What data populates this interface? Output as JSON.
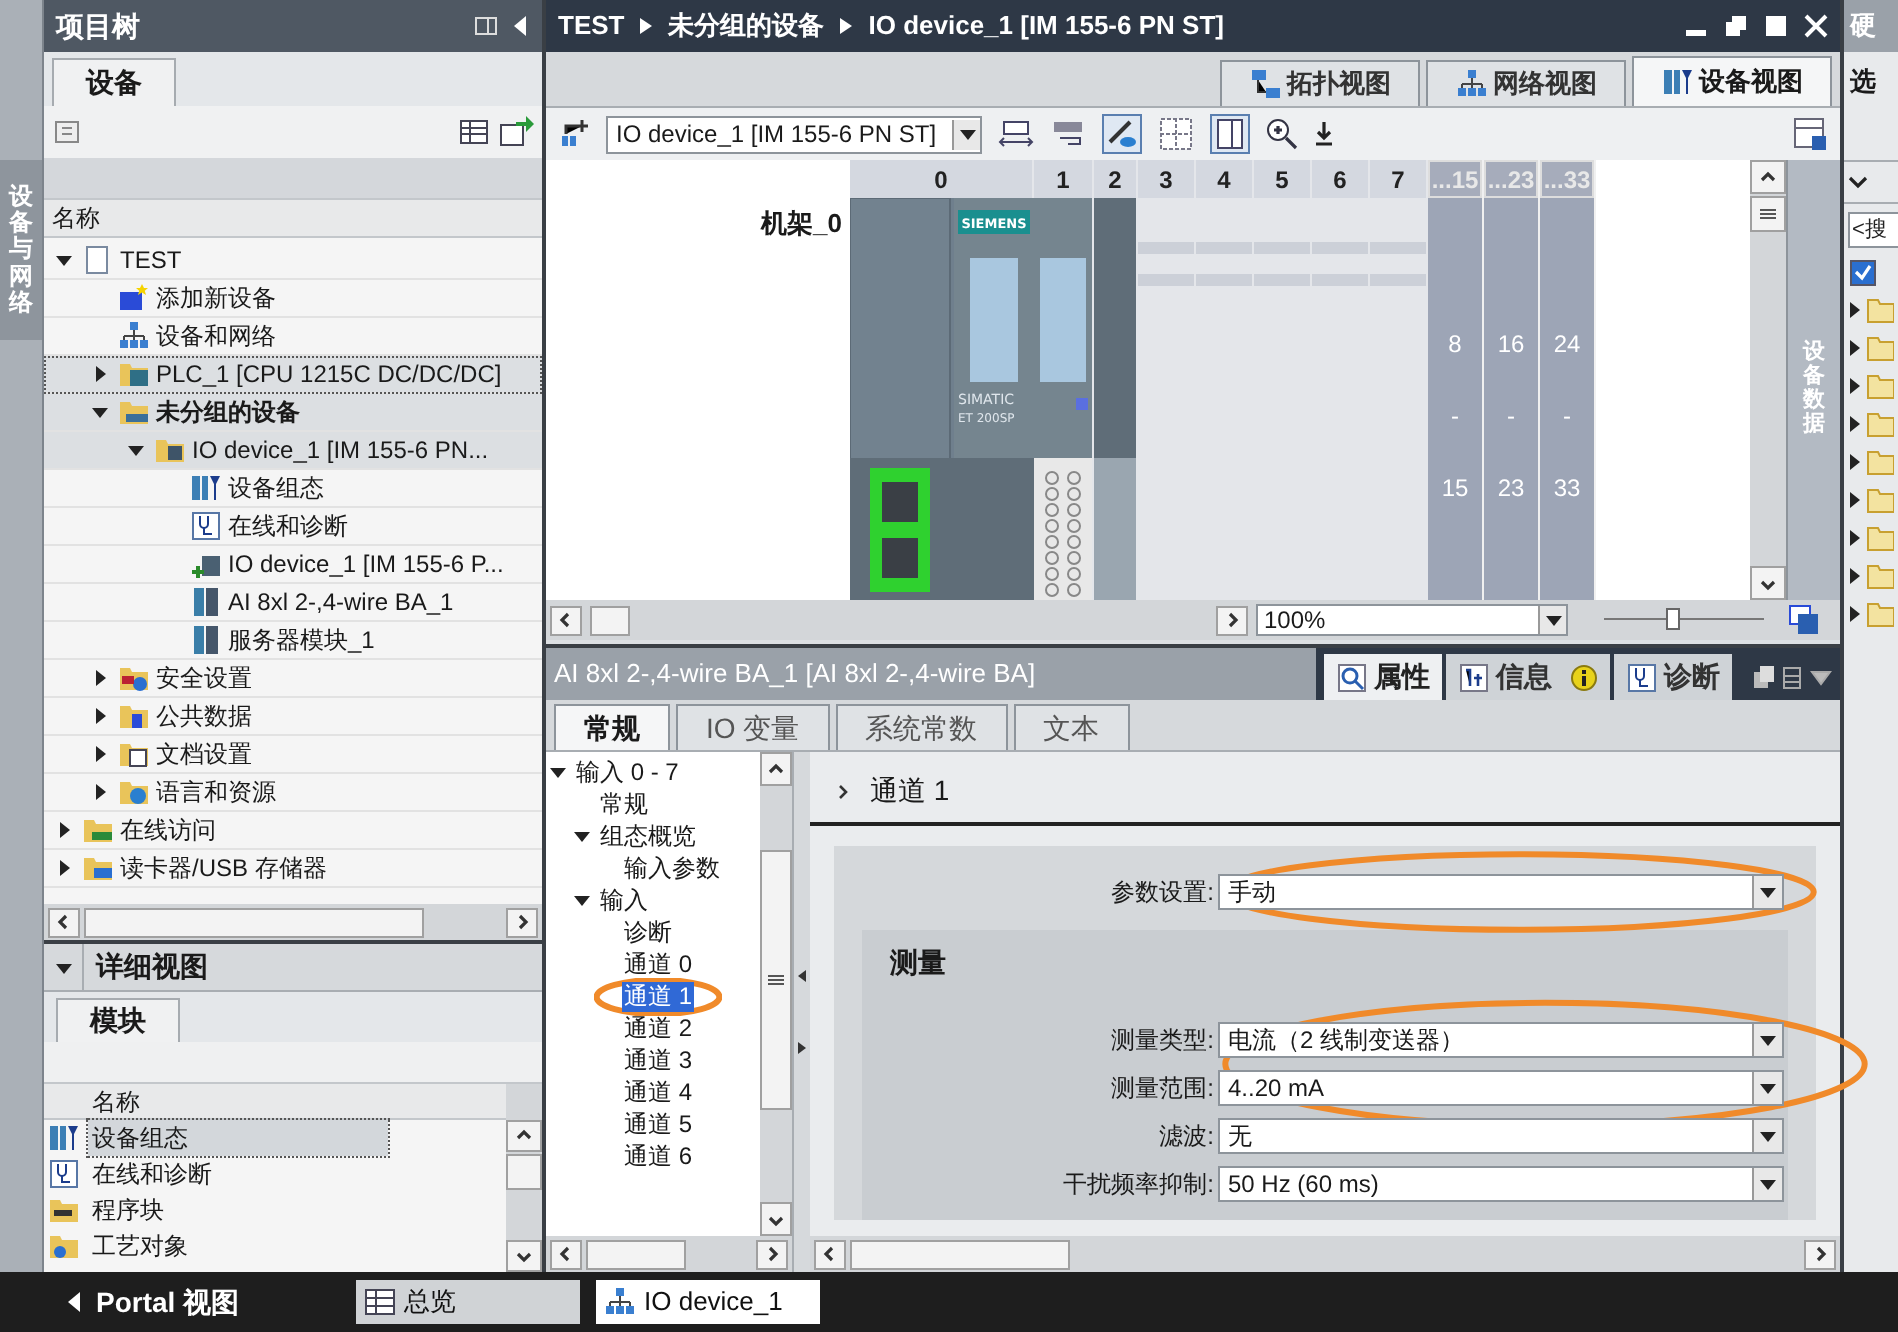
{
  "side_strip": {
    "label": "设备与网络"
  },
  "project_tree": {
    "title": "项目树",
    "tabs": [
      {
        "label": "设备",
        "selected": true
      }
    ],
    "column": "名称",
    "items": [
      {
        "label": "TEST",
        "kind": "project",
        "expanded": true,
        "highlighted": false,
        "selected": false,
        "children": [
          {
            "label": "添加新设备",
            "kind": "add-device",
            "selected": false
          },
          {
            "label": "设备和网络",
            "kind": "network",
            "selected": false
          },
          {
            "label": "PLC_1 [CPU 1215C DC/DC/DC]",
            "kind": "plc",
            "expanded": false,
            "highlighted": true,
            "selected": true
          },
          {
            "label": "未分组的设备",
            "kind": "group",
            "expanded": true,
            "highlighted": true,
            "bold": true,
            "selected": false,
            "children": [
              {
                "label": "IO device_1 [IM 155-6 PN...",
                "kind": "device",
                "expanded": true,
                "highlighted": true,
                "selected": false,
                "children": [
                  {
                    "label": "设备组态",
                    "kind": "config",
                    "selected": false
                  },
                  {
                    "label": "在线和诊断",
                    "kind": "diagnostics",
                    "selected": false
                  },
                  {
                    "label": "IO device_1 [IM 155-6 P...",
                    "kind": "device-module",
                    "selected": false
                  },
                  {
                    "label": "AI 8xl 2-,4-wire BA_1",
                    "kind": "module",
                    "selected": false
                  },
                  {
                    "label": "服务器模块_1",
                    "kind": "module",
                    "selected": false
                  }
                ]
              }
            ]
          },
          {
            "label": "安全设置",
            "kind": "security",
            "expanded": false,
            "highlighted": false,
            "selected": false
          },
          {
            "label": "公共数据",
            "kind": "common-data",
            "expanded": false,
            "highlighted": false,
            "selected": false
          },
          {
            "label": "文档设置",
            "kind": "document",
            "expanded": false,
            "highlighted": false,
            "selected": false
          },
          {
            "label": "语言和资源",
            "kind": "language",
            "expanded": false,
            "highlighted": false,
            "selected": false
          }
        ]
      },
      {
        "label": "在线访问",
        "kind": "online",
        "expanded": false,
        "highlighted": false,
        "selected": false
      },
      {
        "label": "读卡器/USB 存储器",
        "kind": "card-reader",
        "expanded": false,
        "highlighted": false,
        "selected": false
      }
    ]
  },
  "detail_view": {
    "title": "详细视图",
    "expanded": true,
    "tabs": [
      {
        "label": "模块",
        "selected": true
      }
    ],
    "column": "名称",
    "rows": [
      {
        "label": "设备组态",
        "kind": "config",
        "selected": true
      },
      {
        "label": "在线和诊断",
        "kind": "diagnostics",
        "selected": false
      },
      {
        "label": "程序块",
        "kind": "program",
        "selected": false
      },
      {
        "label": "工艺对象",
        "kind": "technology",
        "selected": false
      }
    ]
  },
  "editor": {
    "breadcrumb": [
      "TEST",
      "未分组的设备",
      "IO device_1 [IM 155-6 PN ST]"
    ],
    "view_tabs": [
      {
        "label": "拓扑视图",
        "kind": "topology",
        "selected": false
      },
      {
        "label": "网络视图",
        "kind": "network",
        "selected": false
      },
      {
        "label": "设备视图",
        "kind": "device",
        "selected": true
      }
    ],
    "device_select": "IO device_1 [IM 155-6 PN ST]",
    "rack_label": "机架_0",
    "head_module": {
      "brand": "SIEMENS",
      "product": "SIMATIC",
      "model": "ET 200SP"
    },
    "slots": [
      {
        "label": "0",
        "kind": "head"
      },
      {
        "label": "1",
        "kind": "module"
      },
      {
        "label": "2",
        "kind": "server"
      },
      {
        "label": "3",
        "kind": "empty"
      },
      {
        "label": "4",
        "kind": "empty"
      },
      {
        "label": "5",
        "kind": "empty"
      },
      {
        "label": "6",
        "kind": "empty"
      },
      {
        "label": "7",
        "kind": "empty"
      },
      {
        "label": "...15",
        "kind": "range",
        "from": "8",
        "dash": "-",
        "to": "15"
      },
      {
        "label": "...23",
        "kind": "range",
        "from": "16",
        "dash": "-",
        "to": "23"
      },
      {
        "label": "...33",
        "kind": "range",
        "from": "24",
        "dash": "-",
        "to": "33"
      }
    ],
    "side_tab": "设备数据",
    "zoom": "100%",
    "zoom_slider": {
      "level": 0.42
    }
  },
  "inspector": {
    "title": "AI 8xl 2-,4-wire BA_1 [AI 8xl 2-,4-wire BA]",
    "panel_tabs": [
      {
        "label": "属性",
        "kind": "properties",
        "selected": true
      },
      {
        "label": "信息",
        "kind": "info",
        "selected": false
      },
      {
        "label": "诊断",
        "kind": "diagnostics",
        "selected": false
      }
    ],
    "tabs": [
      {
        "label": "常规",
        "selected": true
      },
      {
        "label": "IO 变量",
        "selected": false
      },
      {
        "label": "系统常数",
        "selected": false
      },
      {
        "label": "文本",
        "selected": false
      }
    ],
    "nav": [
      {
        "label": "输入 0 - 7",
        "expanded": true,
        "selected": false,
        "children": [
          {
            "label": "常规",
            "selected": false
          },
          {
            "label": "组态概览",
            "expanded": true,
            "selected": false,
            "children": [
              {
                "label": "输入参数",
                "selected": false
              }
            ]
          },
          {
            "label": "输入",
            "expanded": true,
            "selected": false,
            "children": [
              {
                "label": "诊断",
                "selected": false
              },
              {
                "label": "通道 0",
                "selected": false
              },
              {
                "label": "通道 1",
                "selected": true,
                "circled": true
              },
              {
                "label": "通道 2",
                "selected": false
              },
              {
                "label": "通道 3",
                "selected": false
              },
              {
                "label": "通道 4",
                "selected": false
              },
              {
                "label": "通道 5",
                "selected": false
              },
              {
                "label": "通道 6",
                "selected": false
              }
            ]
          }
        ]
      }
    ],
    "section": "通道 1",
    "param_field": {
      "label": "参数设置:",
      "value": "手动",
      "circled": true
    },
    "group": {
      "title": "测量",
      "fields": [
        {
          "label": "测量类型:",
          "value": "电流（2 线制变送器）",
          "circled": true
        },
        {
          "label": "测量范围:",
          "value": "4..20 mA",
          "circled": true
        },
        {
          "label": "滤波:",
          "value": "无",
          "circled": false
        },
        {
          "label": "干扰频率抑制:",
          "value": "50 Hz (60 ms)",
          "circled": false
        }
      ]
    }
  },
  "right_panel": {
    "title": "硬",
    "tab": "选",
    "search_placeholder": "<搜",
    "filter_checked": true
  },
  "taskbar": {
    "portal": "Portal 视图",
    "items": [
      {
        "label": "总览",
        "kind": "overview",
        "selected": false
      },
      {
        "label": "IO device_1",
        "kind": "network",
        "selected": true
      }
    ]
  }
}
